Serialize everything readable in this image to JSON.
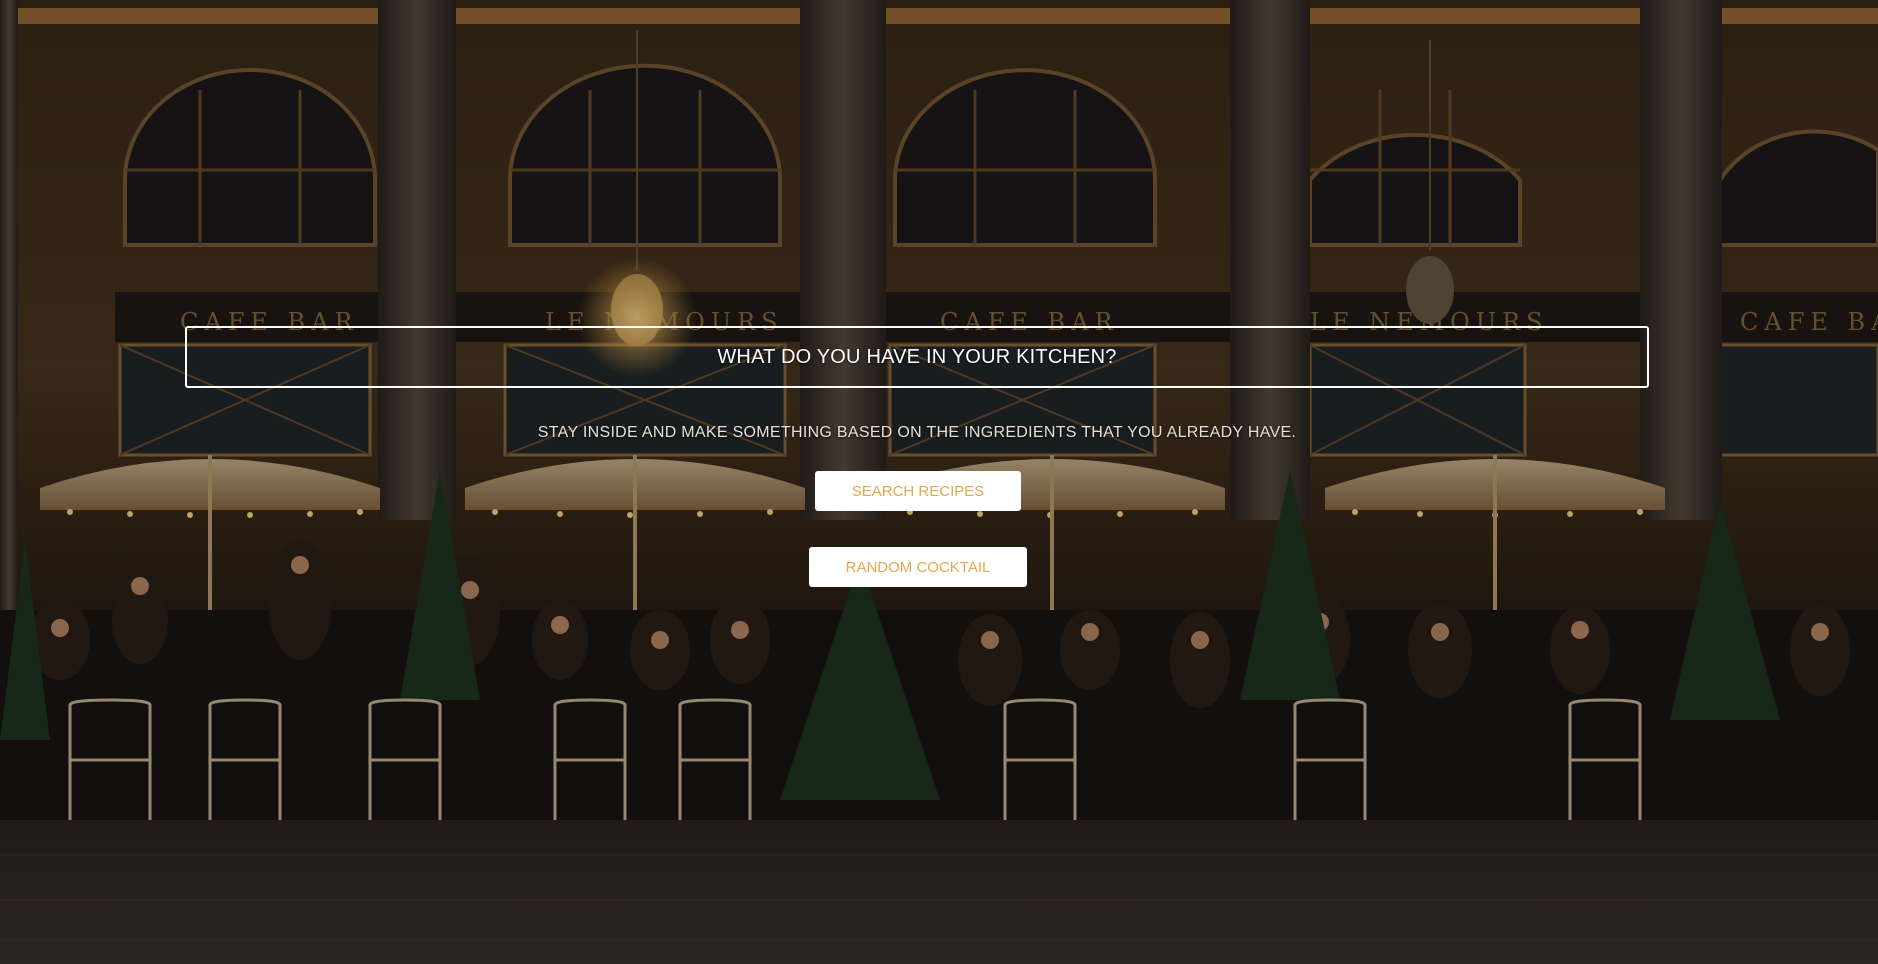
{
  "hero": {
    "title": "WHAT DO YOU HAVE IN YOUR KITCHEN?",
    "subtitle": "STAY INSIDE AND MAKE SOMETHING BASED ON THE INGREDIENTS THAT YOU ALREADY HAVE.",
    "search_button": "SEARCH RECIPES",
    "cocktail_button": "RANDOM COCKTAIL",
    "background_image": "night-cafe-terrace-photo"
  },
  "colors": {
    "button_text": "#e3a84d",
    "button_bg": "#ffffff",
    "title_border": "#ffffff"
  }
}
